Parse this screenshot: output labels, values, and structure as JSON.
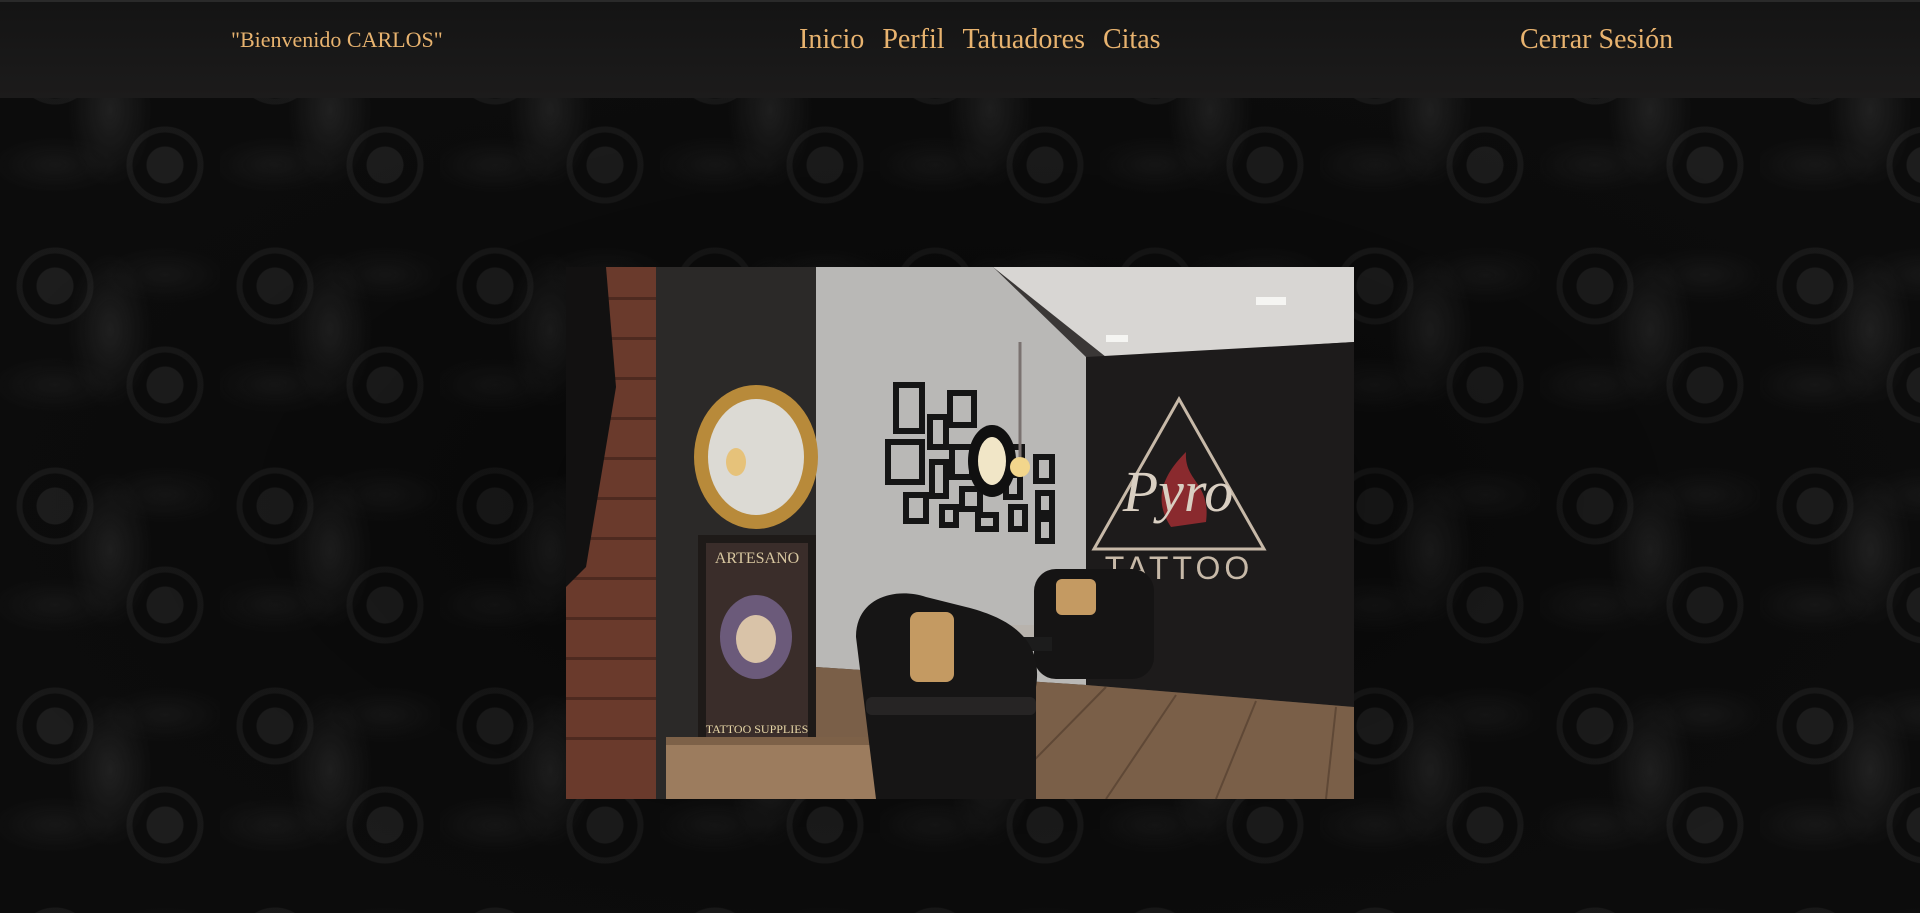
{
  "header": {
    "welcome_text": "\"Bienvenido CARLOS\"",
    "nav": [
      {
        "label": "Inicio"
      },
      {
        "label": "Perfil"
      },
      {
        "label": "Tatuadores"
      },
      {
        "label": "Citas"
      }
    ],
    "logout_label": "Cerrar Sesión"
  },
  "studio_photo": {
    "wall_sign_script": "Pyro",
    "wall_sign_word": "TATTOO",
    "poster_title": "ARTESANO",
    "poster_caption": "TATTOO SUPPLIES"
  },
  "colors": {
    "accent": "#e8b36f",
    "topbar": "#1a1919",
    "background": "#0c0c0c"
  }
}
